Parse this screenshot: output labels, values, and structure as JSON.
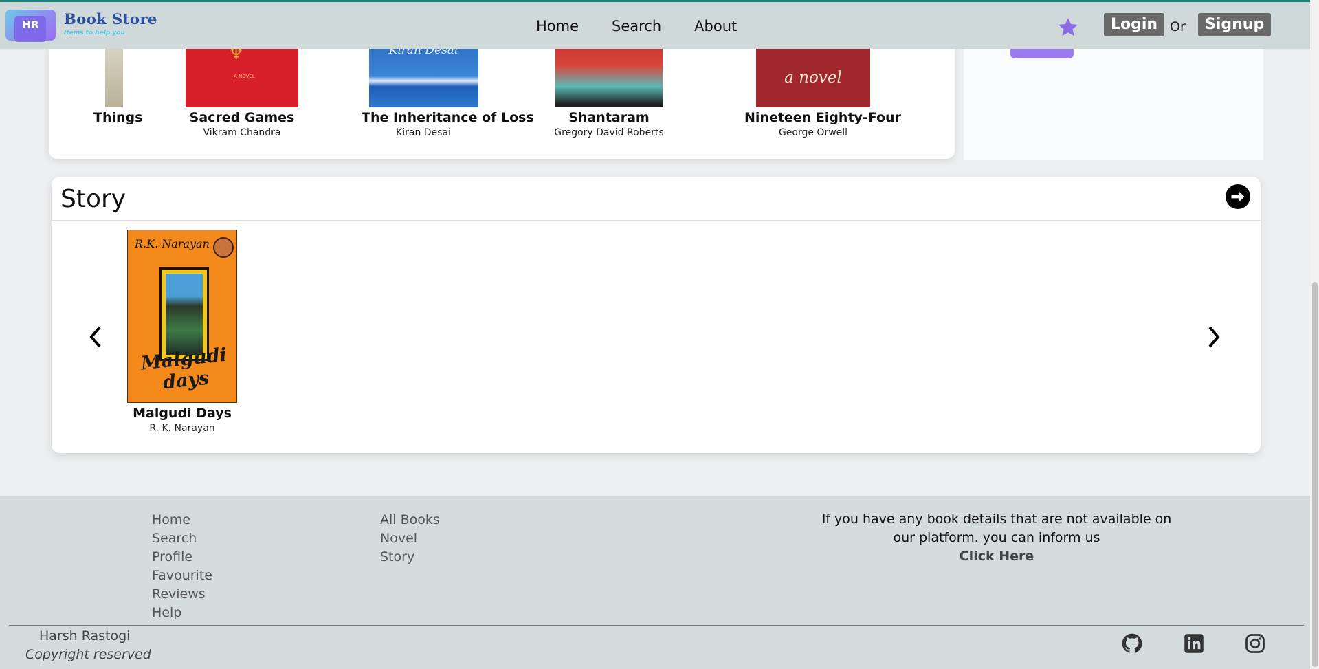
{
  "header": {
    "logo_initials": "HR",
    "brand_title": "Book Store",
    "brand_tagline": "Items to help you",
    "nav": [
      "Home",
      "Search",
      "About"
    ],
    "login_label": "Login",
    "or_label": "Or",
    "signup_label": "Signup"
  },
  "top_carousel": {
    "books": [
      {
        "title": "Things",
        "author": ""
      },
      {
        "title": "Sacred Games",
        "author": "Vikram Chandra"
      },
      {
        "title": "The Inheritance of Loss",
        "author": "Kiran Desai"
      },
      {
        "title": "Shantaram",
        "author": "Gregory David Roberts"
      },
      {
        "title": "Nineteen Eighty-Four",
        "author": "George Orwell"
      }
    ],
    "cover_texts": {
      "sacred": "A NOVEL",
      "inheritance": "Kiran Desai",
      "nineteen": "a novel"
    }
  },
  "story": {
    "heading": "Story",
    "books": [
      {
        "title": "Malgudi Days",
        "author": "R. K. Narayan",
        "cover_author": "R.K. Narayan",
        "cover_title": "Malgudi days"
      }
    ]
  },
  "footer": {
    "col1": [
      "Home",
      "Search",
      "Profile",
      "Favourite",
      "Reviews",
      "Help"
    ],
    "col2": [
      "All Books",
      "Novel",
      "Story"
    ],
    "info_text": "If you have any book details that are not available on our platform. you can inform us",
    "click_label": "Click Here",
    "author_name": "Harsh Rastogi",
    "copyright": "Copyright reserved"
  },
  "colors": {
    "navbar_bg": "#cfd9da",
    "footer_bg": "#d4dcde",
    "accent_purple": "#9a7cf0",
    "brand_blue": "#2b4fa0"
  },
  "icons": [
    "star-icon",
    "arrow-circle-right-icon",
    "chevron-left-icon",
    "chevron-right-icon",
    "github-icon",
    "linkedin-icon",
    "instagram-icon"
  ]
}
